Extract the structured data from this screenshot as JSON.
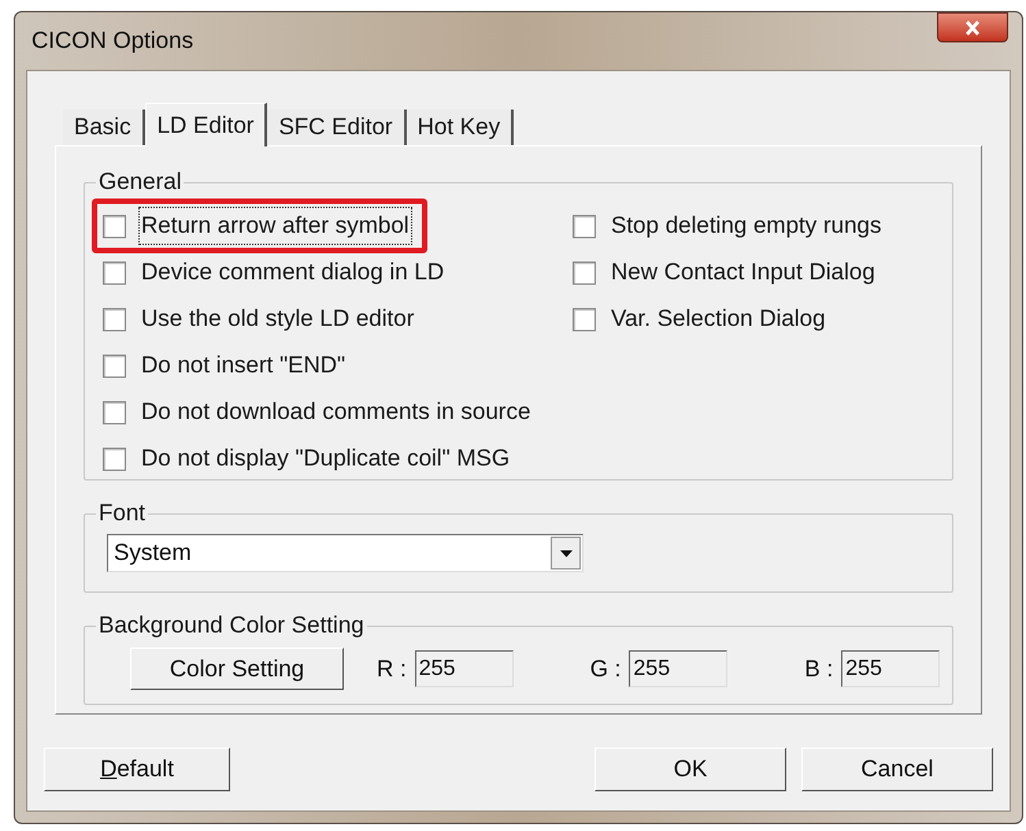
{
  "window": {
    "title": "CICON Options"
  },
  "tabs": [
    {
      "label": "Basic",
      "selected": false
    },
    {
      "label": "LD Editor",
      "selected": true
    },
    {
      "label": "SFC Editor",
      "selected": false
    },
    {
      "label": "Hot Key",
      "selected": false
    }
  ],
  "general": {
    "title": "General",
    "left_options": [
      {
        "label": "Return arrow after symbol",
        "checked": false,
        "focused": true,
        "highlighted": true
      },
      {
        "label": "Device comment dialog in LD",
        "checked": false,
        "focused": false,
        "highlighted": false
      },
      {
        "label": "Use the old style LD editor",
        "checked": false,
        "focused": false,
        "highlighted": false
      },
      {
        "label": "Do not insert \"END\"",
        "checked": false,
        "focused": false,
        "highlighted": false
      },
      {
        "label": "Do not download comments in source",
        "checked": false,
        "focused": false,
        "highlighted": false
      },
      {
        "label": "Do not display \"Duplicate coil\" MSG",
        "checked": false,
        "focused": false,
        "highlighted": false
      }
    ],
    "right_options": [
      {
        "label": "Stop deleting empty rungs",
        "checked": false,
        "focused": false,
        "highlighted": false
      },
      {
        "label": "New Contact Input Dialog",
        "checked": false,
        "focused": false,
        "highlighted": false
      },
      {
        "label": "Var. Selection Dialog",
        "checked": false,
        "focused": false,
        "highlighted": false
      }
    ]
  },
  "font": {
    "title": "Font",
    "value": "System"
  },
  "background_color": {
    "title": "Background Color Setting",
    "button": "Color Setting",
    "channels": [
      {
        "label": "R :",
        "value": "255"
      },
      {
        "label": "G :",
        "value": "255"
      },
      {
        "label": "B :",
        "value": "255"
      }
    ]
  },
  "buttons": [
    {
      "label": "Default",
      "mnemonic": true,
      "kind": "left"
    },
    {
      "label": "OK",
      "mnemonic": false,
      "kind": "right"
    },
    {
      "label": "Cancel",
      "mnemonic": false,
      "kind": "right"
    }
  ]
}
